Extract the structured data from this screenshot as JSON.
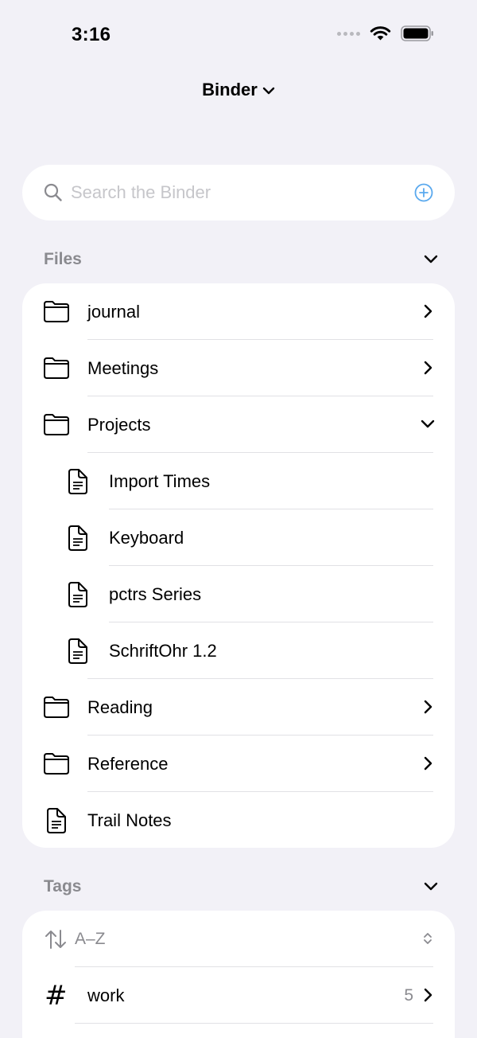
{
  "status_bar": {
    "time": "3:16"
  },
  "nav": {
    "title": "Binder"
  },
  "search": {
    "placeholder": "Search the Binder"
  },
  "files": {
    "header": "Files",
    "items": [
      {
        "label": "journal",
        "type": "folder",
        "trail": "chevron-right"
      },
      {
        "label": "Meetings",
        "type": "folder",
        "trail": "chevron-right"
      },
      {
        "label": "Projects",
        "type": "folder",
        "trail": "chevron-down"
      },
      {
        "label": "Import Times",
        "type": "document",
        "indent": 1
      },
      {
        "label": "Keyboard",
        "type": "document",
        "indent": 1
      },
      {
        "label": "pctrs Series",
        "type": "document",
        "indent": 1
      },
      {
        "label": "SchriftOhr 1.2",
        "type": "document",
        "indent": 1
      },
      {
        "label": "Reading",
        "type": "folder",
        "trail": "chevron-right"
      },
      {
        "label": "Reference",
        "type": "folder",
        "trail": "chevron-right"
      },
      {
        "label": "Trail Notes",
        "type": "document"
      }
    ]
  },
  "tags": {
    "header": "Tags",
    "sort_label": "A–Z",
    "items": [
      {
        "label": "work",
        "count": "5"
      }
    ]
  },
  "colors": {
    "accent": "#5aa9ee",
    "background": "#f2f1f7",
    "secondary_text": "#8a8a8f"
  }
}
